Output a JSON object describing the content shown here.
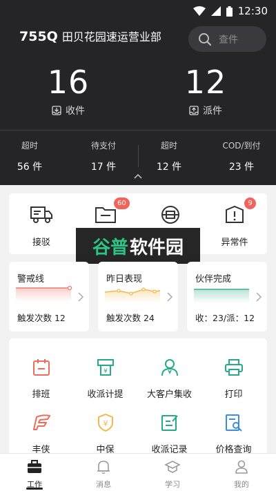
{
  "status_bar": {
    "time": "12:30"
  },
  "header": {
    "station_code": "755Q",
    "station_name": "田贝花园速运营业部",
    "search_placeholder": "查件"
  },
  "summary": {
    "collect": {
      "value": "16",
      "label": "收件"
    },
    "dispatch": {
      "value": "12",
      "label": "派件"
    }
  },
  "stats": [
    {
      "title": "超时",
      "value": "56 件"
    },
    {
      "title": "待支付",
      "value": "17 件"
    },
    {
      "title": "超时",
      "value": "12 件"
    },
    {
      "title": "COD/到付",
      "value": "23 件"
    }
  ],
  "quick_actions": [
    {
      "label": "接驳",
      "icon": "truck-icon",
      "badge": ""
    },
    {
      "label": "",
      "icon": "folder-icon",
      "badge": "60"
    },
    {
      "label": "",
      "icon": "scan-package-icon",
      "badge": ""
    },
    {
      "label": "异常件",
      "icon": "warning-box-icon",
      "badge": "9"
    }
  ],
  "watermark": {
    "part1": "谷普",
    "part2": "软件园"
  },
  "indicators": [
    {
      "title": "警戒线",
      "footer": "触发次数 12",
      "color": "#f07a6e"
    },
    {
      "title": "昨日表现",
      "footer": "触发次数 24",
      "color": "#f2b84b"
    },
    {
      "title": "伙伴完成",
      "footer": "收：23/派：12",
      "color": "#35b08a"
    }
  ],
  "tools": [
    {
      "label": "排班",
      "icon": "calendar-icon",
      "color": "#ef6a5b"
    },
    {
      "label": "收派计提",
      "icon": "atm-icon",
      "color": "#26a98b"
    },
    {
      "label": "大客户集收",
      "icon": "user-icon",
      "color": "#26a98b"
    },
    {
      "label": "打印",
      "icon": "printer-icon",
      "color": "#26a98b"
    },
    {
      "label": "丰侠",
      "icon": "feather-icon",
      "color": "#ef6a5b"
    },
    {
      "label": "中保",
      "icon": "shield-yen-icon",
      "color": "#f2b84b"
    },
    {
      "label": "收派记录",
      "icon": "edit-record-icon",
      "color": "#26a98b"
    },
    {
      "label": "价格查询",
      "icon": "doc-search-icon",
      "color": "#3a8de0"
    }
  ],
  "tabs": [
    {
      "label": "工作",
      "icon": "briefcase-icon",
      "active": true
    },
    {
      "label": "消息",
      "icon": "bell-icon",
      "active": false
    },
    {
      "label": "学习",
      "icon": "graduation-icon",
      "active": false
    },
    {
      "label": "我的",
      "icon": "person-icon",
      "active": false
    }
  ]
}
